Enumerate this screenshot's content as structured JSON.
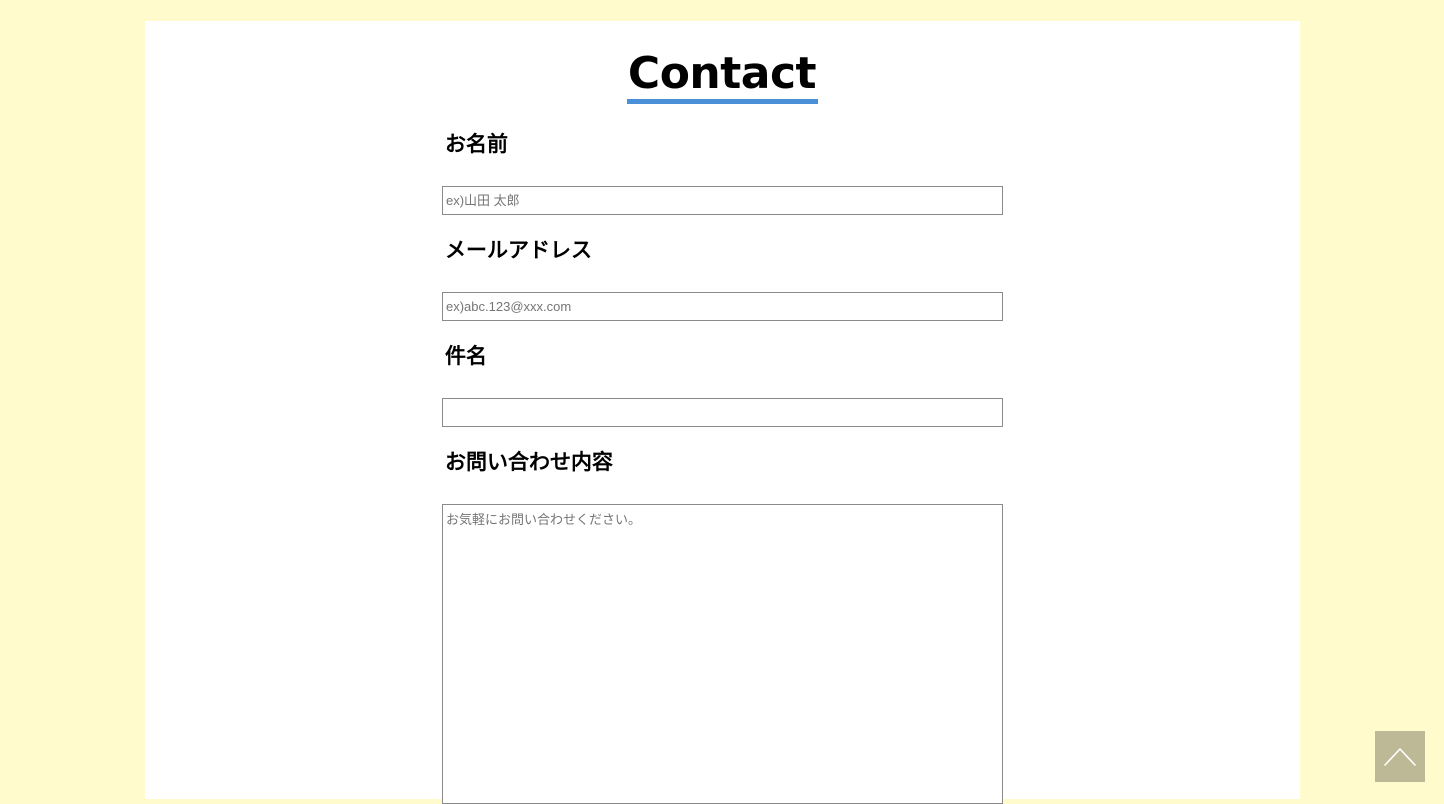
{
  "page": {
    "title": "Contact"
  },
  "form": {
    "name": {
      "label": "お名前",
      "value": "",
      "placeholder": "ex)山田 太郎"
    },
    "email": {
      "label": "メールアドレス",
      "value": "",
      "placeholder": "ex)abc.123@xxx.com"
    },
    "subject": {
      "label": "件名",
      "value": "",
      "placeholder": ""
    },
    "message": {
      "label": "お問い合わせ内容",
      "value": "",
      "placeholder": "お気軽にお問い合わせください。"
    }
  },
  "scroll_top": {
    "icon": "chevron-up-icon"
  },
  "colors": {
    "page_background": "#fffbcc",
    "panel_background": "#ffffff",
    "title_underline": "#4a90d9",
    "scroll_top_background": "#bdb895"
  }
}
